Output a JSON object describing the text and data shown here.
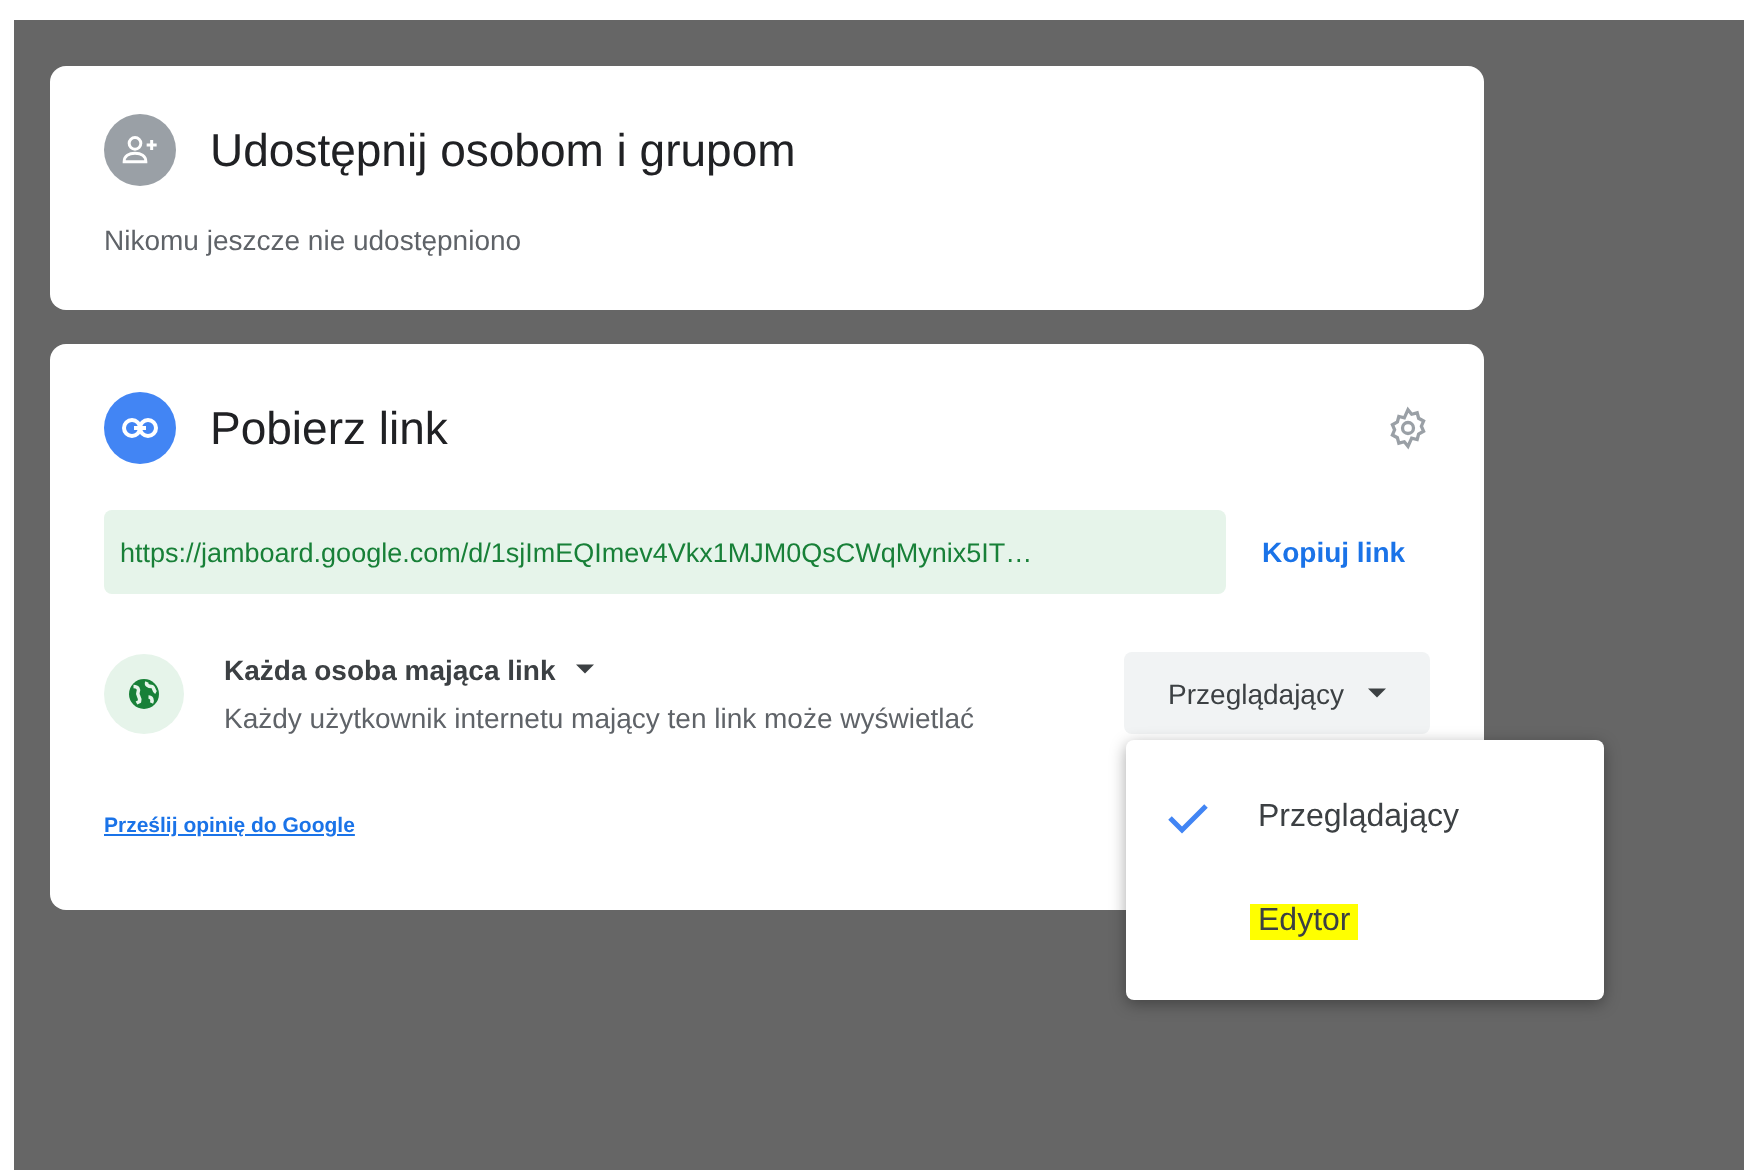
{
  "share_people": {
    "title": "Udostępnij osobom i grupom",
    "subtitle": "Nikomu jeszcze nie udostępniono"
  },
  "get_link": {
    "title": "Pobierz link",
    "url": "https://jamboard.google.com/d/1sjImEQImev4Vkx1MJM0QsCWqMynix5IT…",
    "copy_label": "Kopiuj link",
    "access_label": "Każda osoba mająca link",
    "access_description": "Każdy użytkownik internetu mający ten link może wyświetlać",
    "role": "Przeglądający",
    "feedback_link": "Prześlij opinię do Google"
  },
  "role_menu": [
    {
      "label": "Przeglądający",
      "selected": true,
      "highlighted": false
    },
    {
      "label": "Edytor",
      "selected": false,
      "highlighted": true
    }
  ]
}
